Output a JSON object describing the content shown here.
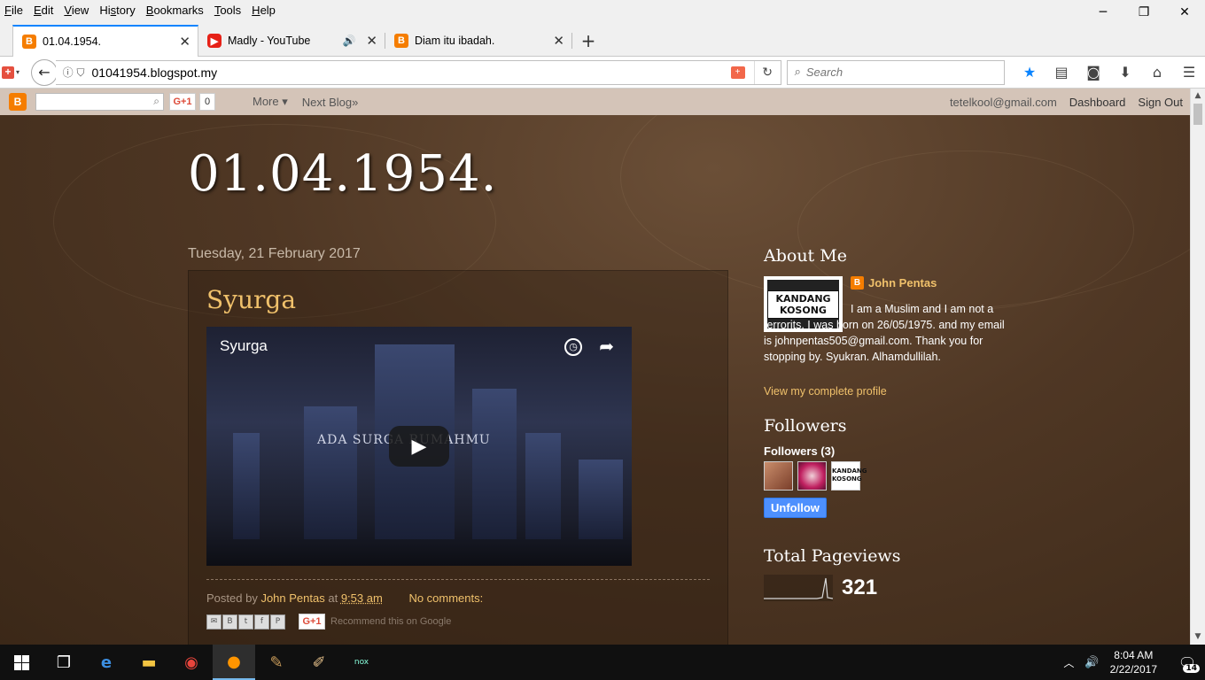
{
  "menu": {
    "items": [
      {
        "u": "F",
        "rest": "ile"
      },
      {
        "u": "E",
        "rest": "dit"
      },
      {
        "u": "V",
        "rest": "iew"
      },
      {
        "pre": "Hi",
        "u": "s",
        "rest": "tory"
      },
      {
        "u": "B",
        "rest": "ookmarks"
      },
      {
        "u": "T",
        "rest": "ools"
      },
      {
        "u": "H",
        "rest": "elp"
      }
    ]
  },
  "window_controls": {
    "minimize": "─",
    "restore": "❐",
    "close": "✕"
  },
  "tabs": [
    {
      "label": "01.04.1954.",
      "icon": "blogger-icon",
      "active": true
    },
    {
      "label": "Madly - YouTube",
      "icon": "youtube-icon",
      "audio": true
    },
    {
      "label": "Diam itu ibadah.",
      "icon": "blogger-icon"
    }
  ],
  "tab_close": "✕",
  "new_tab": "+",
  "navbar": {
    "url": "01041954.blogspot.my",
    "search_placeholder": "Search",
    "back": "←",
    "reload": "↻"
  },
  "blogger_bar": {
    "gplus": "G+1",
    "gcount": "0",
    "more": "More ▾",
    "next_blog": "Next Blog»",
    "email": "tetelkool@gmail.com",
    "dashboard": "Dashboard",
    "sign_out": "Sign Out"
  },
  "blog": {
    "title": "01.04.1954.",
    "date_header": "Tuesday, 21 February 2017",
    "post": {
      "title": "Syurga",
      "video_title": "Syurga",
      "video_overlay": "ADA SURGA    RUMAHMU",
      "posted_by": "Posted by",
      "author": "John Pentas",
      "at": "at",
      "time": "9:53 am",
      "comments": "No comments:",
      "share_gplus": "G+1",
      "recommend": "Recommend this on Google"
    }
  },
  "sidebar": {
    "about": {
      "title": "About Me",
      "name": "John Pentas",
      "photo_text": "KANDANG KOSONG",
      "bio": "I am a Muslim and I am not a terrorits. I was born on 26/05/1975. and my email is johnpentas505@gmail.com. Thank you for stopping by. Syukran. Alhamdullilah.",
      "profile_link": "View my complete profile"
    },
    "followers": {
      "title": "Followers",
      "count": "Followers (3)",
      "unfollow": "Unfollow",
      "avatar3_text": "KANDANG KOSONG"
    },
    "pageviews": {
      "title": "Total Pageviews",
      "value": "321"
    }
  },
  "taskbar": {
    "time": "8:04 AM",
    "date": "2/22/2017",
    "notifications": "14"
  }
}
